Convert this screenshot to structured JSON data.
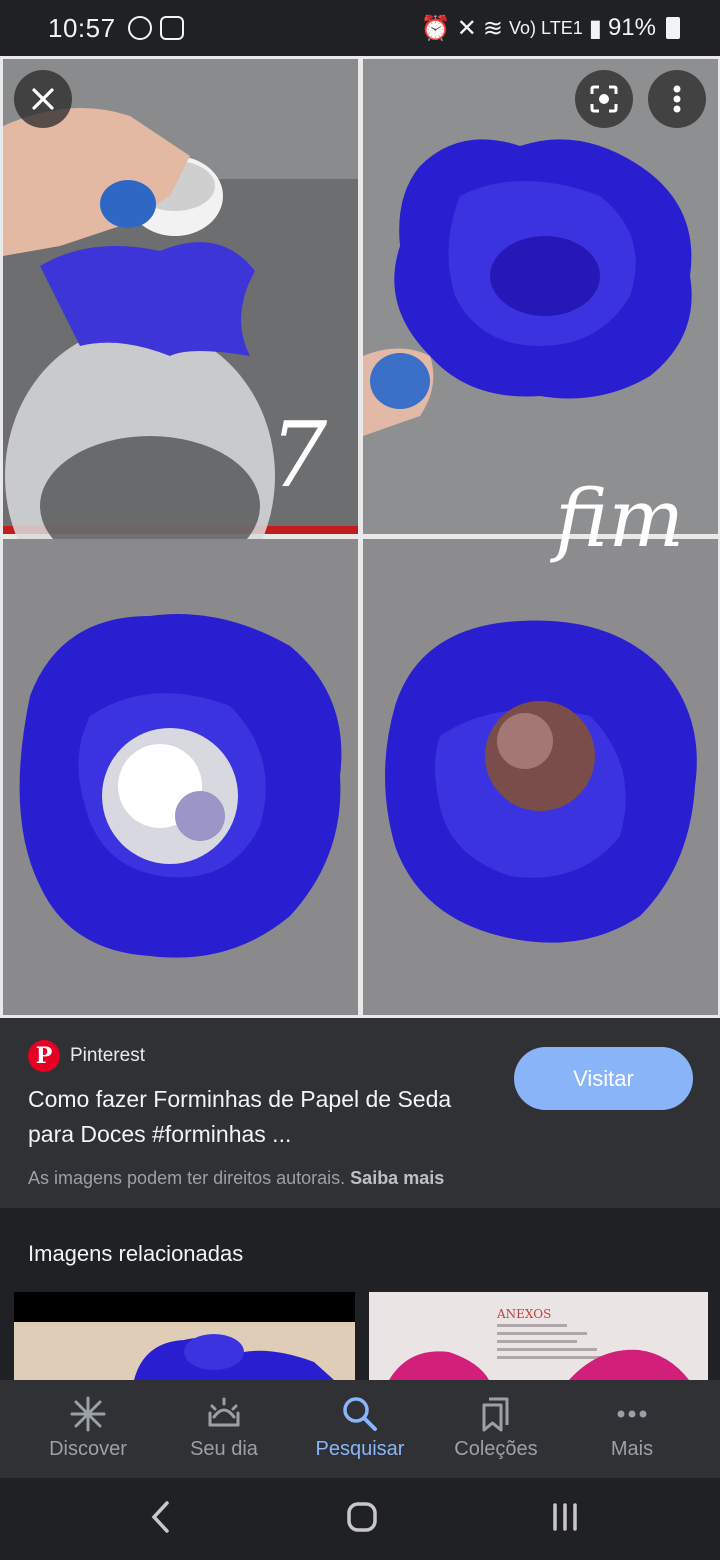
{
  "status_bar": {
    "time": "10:57",
    "lte_label": "Vo) LTE1",
    "battery": "91%"
  },
  "viewer": {
    "close_icon": "close-icon",
    "lens_icon": "google-lens-icon",
    "more_icon": "more-vert-icon",
    "panels": {
      "step_label": "7",
      "end_label": "fim"
    }
  },
  "result": {
    "source": "Pinterest",
    "title": "Como fazer Forminhas de Papel de Seda para Doces #forminhas ...",
    "visit_label": "Visitar",
    "copyright_text": "As imagens podem ter direitos autorais.",
    "learn_more": "Saiba mais"
  },
  "related": {
    "title": "Imagens relacionadas",
    "thumb2_heading": "ANEXOS"
  },
  "bottom_nav": {
    "items": [
      {
        "label": "Discover",
        "icon": "asterisk-icon"
      },
      {
        "label": "Seu dia",
        "icon": "sunrise-icon"
      },
      {
        "label": "Pesquisar",
        "icon": "search-icon"
      },
      {
        "label": "Coleções",
        "icon": "collections-icon"
      },
      {
        "label": "Mais",
        "icon": "more-horiz-icon"
      }
    ]
  },
  "colors": {
    "accent": "#8ab4f8",
    "flower": "#2a1fd0",
    "pinterest": "#e60023"
  }
}
